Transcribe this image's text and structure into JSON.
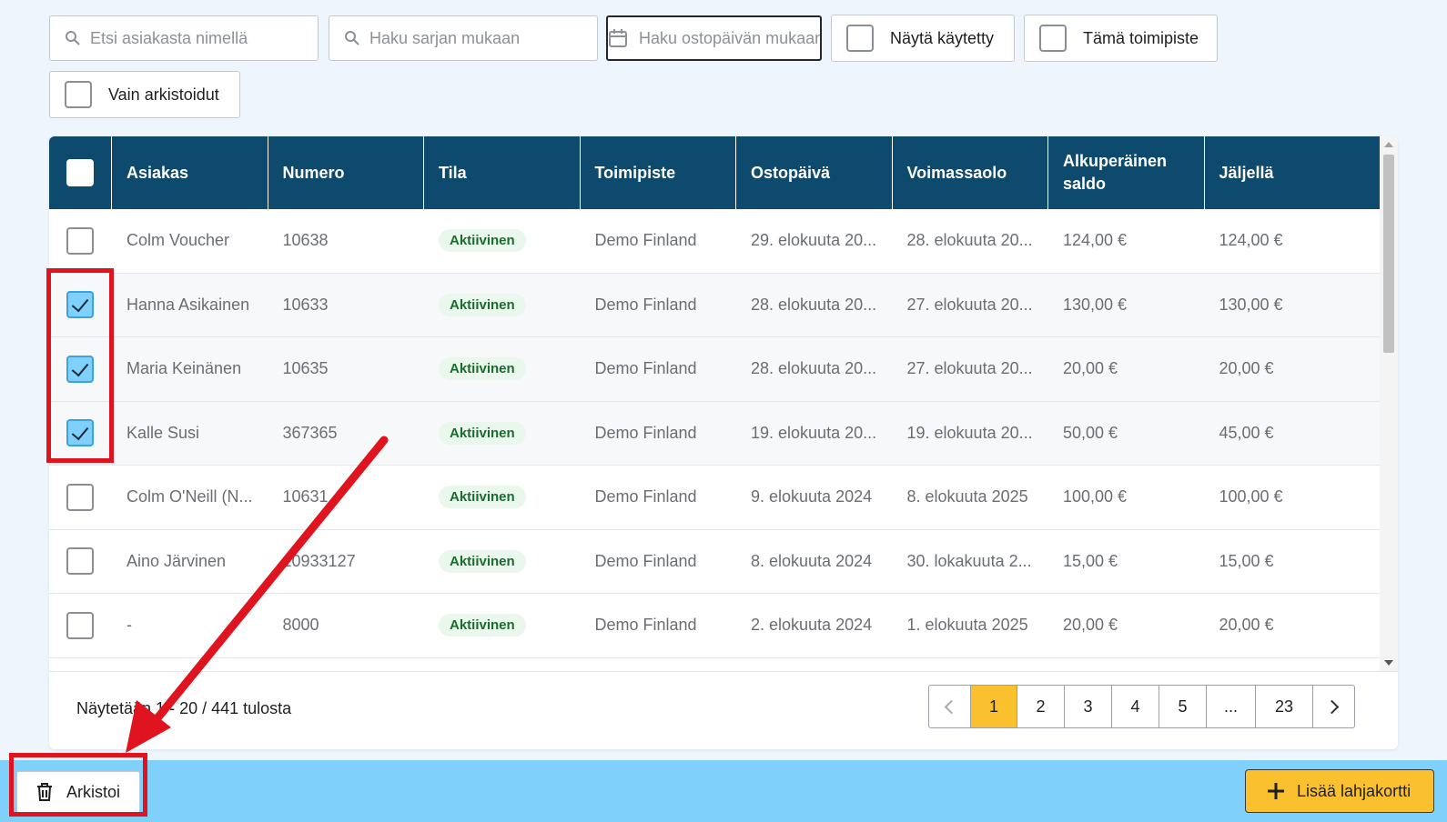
{
  "filters": {
    "customer_search_placeholder": "Etsi asiakasta nimellä",
    "serial_search_placeholder": "Haku sarjan mukaan",
    "purchase_date_placeholder": "Haku ostopäivän mukaan",
    "show_used_label": "Näytä käytetty",
    "this_office_label": "Tämä toimipiste",
    "archived_only_label": "Vain arkistoidut"
  },
  "table": {
    "headers": [
      "Asiakas",
      "Numero",
      "Tila",
      "Toimipiste",
      "Ostopäivä",
      "Voimassaolo",
      "Alkuperäinen saldo",
      "Jäljellä"
    ],
    "rows": [
      {
        "checked": false,
        "customer": "Colm Voucher",
        "number": "10638",
        "status": "Aktiivinen",
        "office": "Demo Finland",
        "purchase_date": "29. elokuuta 20...",
        "valid_until": "28. elokuuta 20...",
        "original_balance": "124,00 €",
        "remaining": "124,00 €"
      },
      {
        "checked": true,
        "customer": "Hanna Asikainen",
        "number": "10633",
        "status": "Aktiivinen",
        "office": "Demo Finland",
        "purchase_date": "28. elokuuta 20...",
        "valid_until": "27. elokuuta 20...",
        "original_balance": "130,00 €",
        "remaining": "130,00 €"
      },
      {
        "checked": true,
        "customer": "Maria Keinänen",
        "number": "10635",
        "status": "Aktiivinen",
        "office": "Demo Finland",
        "purchase_date": "28. elokuuta 20...",
        "valid_until": "27. elokuuta 20...",
        "original_balance": "20,00 €",
        "remaining": "20,00 €"
      },
      {
        "checked": true,
        "customer": "Kalle Susi",
        "number": "367365",
        "status": "Aktiivinen",
        "office": "Demo Finland",
        "purchase_date": "19. elokuuta 20...",
        "valid_until": "19. elokuuta 20...",
        "original_balance": "50,00 €",
        "remaining": "45,00 €"
      },
      {
        "checked": false,
        "customer": "Colm O'Neill (N...",
        "number": "10631",
        "status": "Aktiivinen",
        "office": "Demo Finland",
        "purchase_date": "9. elokuuta 2024",
        "valid_until": "8. elokuuta 2025",
        "original_balance": "100,00 €",
        "remaining": "100,00 €"
      },
      {
        "checked": false,
        "customer": "Aino Järvinen",
        "number": "10933127",
        "status": "Aktiivinen",
        "office": "Demo Finland",
        "purchase_date": "8. elokuuta 2024",
        "valid_until": "30. lokakuuta 2...",
        "original_balance": "15,00 €",
        "remaining": "15,00 €"
      },
      {
        "checked": false,
        "customer": "-",
        "number": "8000",
        "status": "Aktiivinen",
        "office": "Demo Finland",
        "purchase_date": "2. elokuuta 2024",
        "valid_until": "1. elokuuta 2025",
        "original_balance": "20,00 €",
        "remaining": "20,00 €"
      }
    ]
  },
  "footer": {
    "showing_text": "Näytetään 1 - 20 / 441 tulosta",
    "pages": [
      "1",
      "2",
      "3",
      "4",
      "5",
      "...",
      "23"
    ],
    "active_page": "1"
  },
  "actions": {
    "archive_label": "Arkistoi",
    "add_gift_card_label": "Lisää lahjakortti"
  },
  "colors": {
    "header_bg": "#0d4a6e",
    "action_bar_bg": "#7fd0fb",
    "accent_yellow": "#fbc02d",
    "highlight_red": "#e0141f",
    "status_green": "#1b6b2f"
  }
}
